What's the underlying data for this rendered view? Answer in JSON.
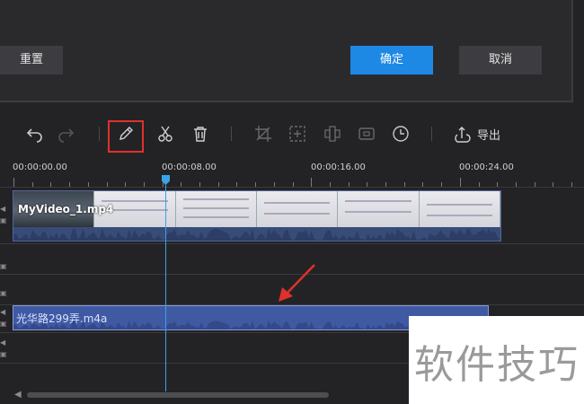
{
  "dialog": {
    "reset_label": "重置",
    "confirm_label": "确定",
    "cancel_label": "取消"
  },
  "toolbar": {
    "tools": [
      "undo-icon",
      "redo-icon",
      "pencil-icon",
      "scissors-icon",
      "trash-icon",
      "crop-icon",
      "zoom-icon",
      "mosaic-icon",
      "freeze-frame-icon",
      "duration-icon",
      "export-icon"
    ],
    "export_label": "导出"
  },
  "ruler": {
    "labels": [
      "00:00:00.00",
      "00:00:08.00",
      "00:00:16.00",
      "00:00:24.00"
    ]
  },
  "timeline": {
    "video_clip_name": "MyVideo_1.mp4",
    "audio_clip_name": "光华路299弄.m4a",
    "playhead_time": "00:00:08.00"
  },
  "watermark": {
    "text": "软件技巧"
  },
  "colors": {
    "accent": "#1e88e5",
    "highlight": "#e0312b",
    "clip": "#3f5aa3",
    "playhead": "#3aa3e8"
  }
}
